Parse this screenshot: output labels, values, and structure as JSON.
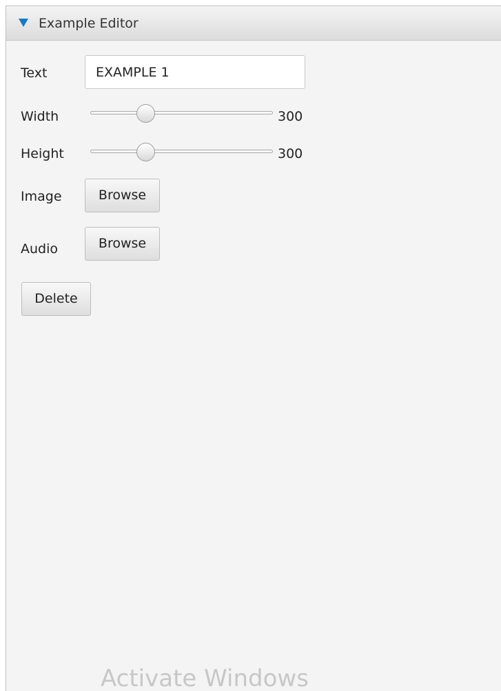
{
  "panel": {
    "title": "Example Editor"
  },
  "fields": {
    "text_label": "Text",
    "text_value": "EXAMPLE 1",
    "width_label": "Width",
    "height_label": "Height",
    "image_label": "Image",
    "audio_label": "Audio"
  },
  "sliders": {
    "width": {
      "value": "300",
      "thumb_fraction": 0.3
    },
    "height": {
      "value": "300",
      "thumb_fraction": 0.3
    }
  },
  "buttons": {
    "browse_image": "Browse",
    "browse_audio": "Browse",
    "delete": "Delete"
  },
  "watermark": {
    "text": "Activate Windows"
  },
  "colors": {
    "panel_background": "#f4f4f4",
    "accent_triangle": "#1479c8",
    "border": "#bfbfbf",
    "watermark": "#c7c7c7"
  },
  "icons": {
    "collapse": "triangle-down-icon"
  }
}
